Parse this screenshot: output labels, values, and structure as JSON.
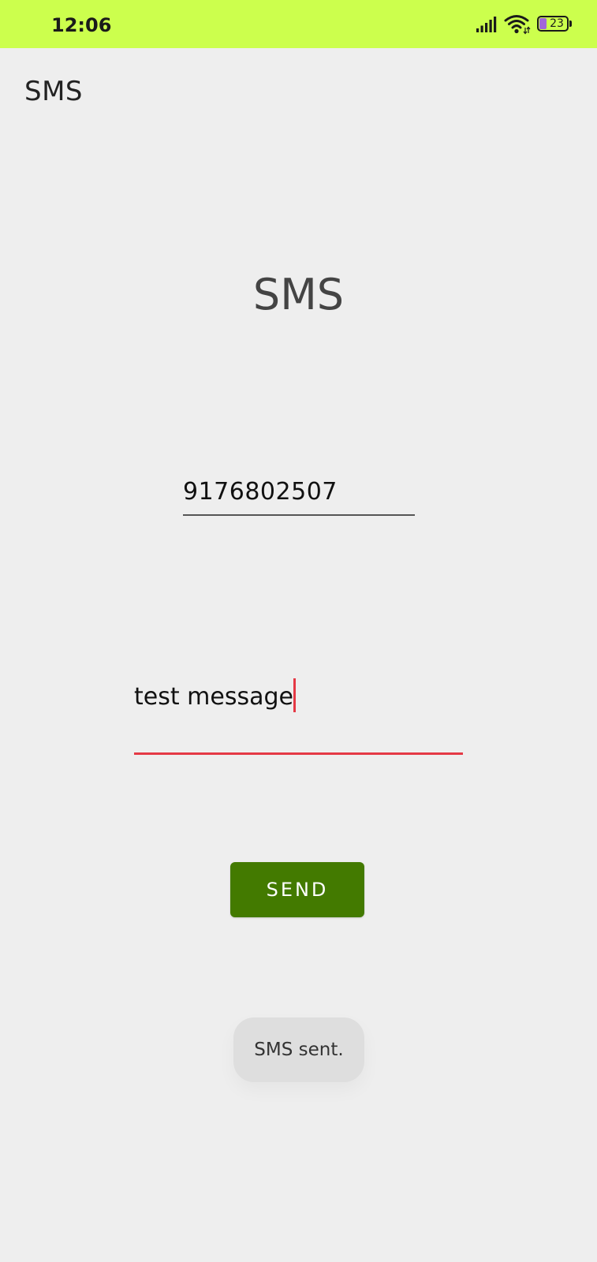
{
  "status_bar": {
    "time": "12:06",
    "battery_level": "23",
    "icons": [
      "signal-icon",
      "wifi-icon",
      "battery-icon"
    ],
    "background_color": "#ccff4d"
  },
  "app_bar": {
    "title": "SMS"
  },
  "main": {
    "heading": "SMS",
    "phone_field": {
      "value": "9176802507"
    },
    "message_field": {
      "value": "test message"
    },
    "send_button_label": "SEND",
    "send_button_color": "#437a00",
    "accent_color": "#e53945"
  },
  "toast": {
    "text": "SMS sent."
  }
}
